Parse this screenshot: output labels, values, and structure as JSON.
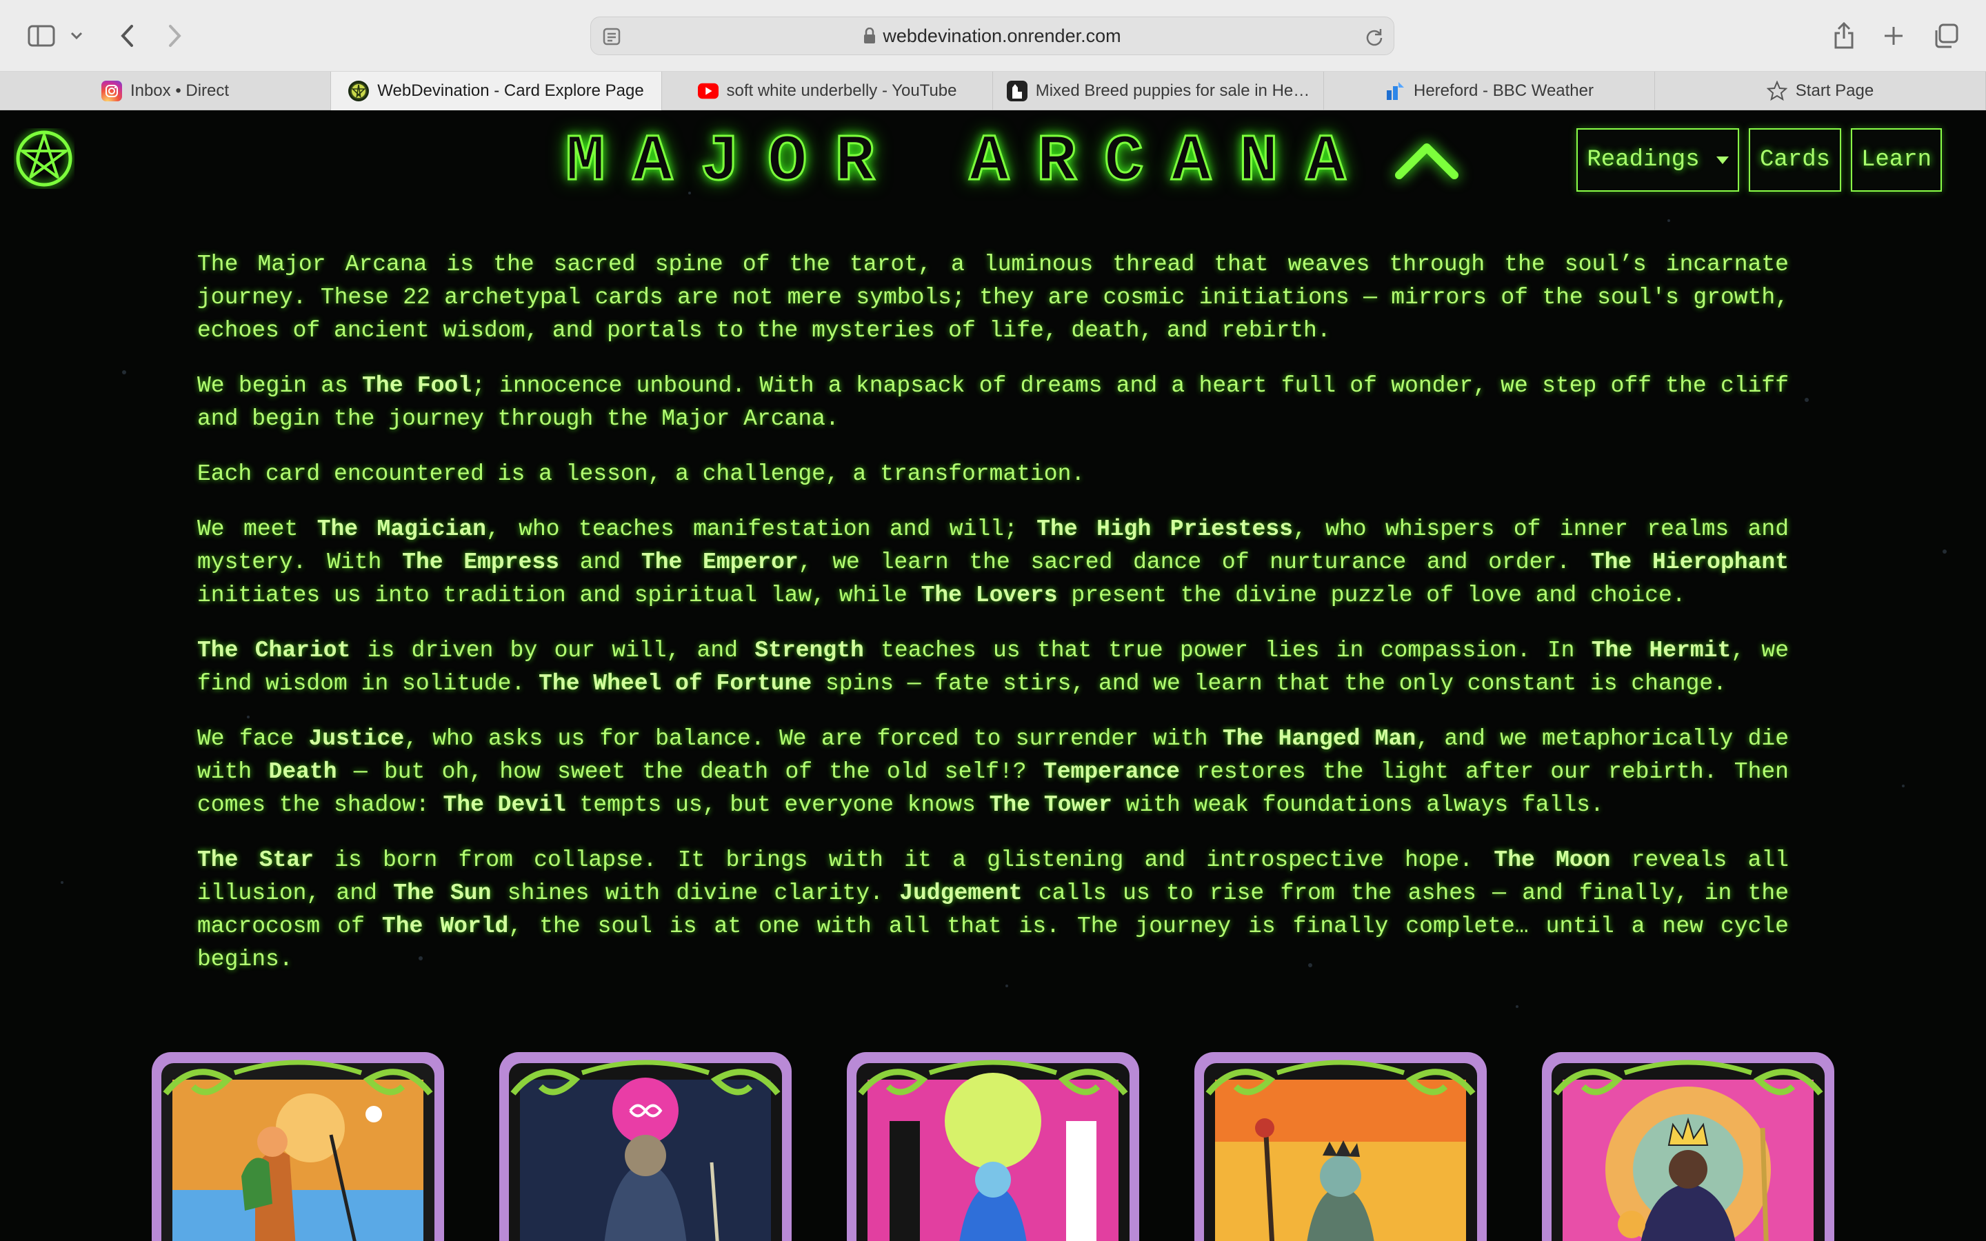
{
  "browser": {
    "url": "webdevination.onrender.com",
    "tabs": [
      {
        "label": "Inbox • Direct",
        "icon": "instagram-icon",
        "active": false
      },
      {
        "label": "WebDevination - Card Explore Page",
        "icon": "webdevination-favicon",
        "active": true
      },
      {
        "label": "soft white underbelly - YouTube",
        "icon": "youtube-icon",
        "active": false
      },
      {
        "label": "Mixed Breed puppies for sale in He…",
        "icon": "puppy-site-favicon",
        "active": false
      },
      {
        "label": "Hereford - BBC Weather",
        "icon": "bbc-weather-icon",
        "active": false
      },
      {
        "label": "Start Page",
        "icon": "star-icon",
        "active": false
      }
    ]
  },
  "header": {
    "title": "MAJOR ARCANA",
    "nav": {
      "readings": "Readings",
      "cards": "Cards",
      "learn": "Learn"
    }
  },
  "article": {
    "p1": [
      {
        "t": "The Major Arcana is the sacred spine of the tarot, a luminous thread that weaves through the soul’s incarnate journey. These 22 archetypal cards are not mere symbols; they are cosmic initiations — mirrors of the soul's growth, echoes of ancient wisdom, and portals to the mysteries of life, death, and rebirth.",
        "b": false
      }
    ],
    "p2": [
      {
        "t": "We begin as ",
        "b": false
      },
      {
        "t": "The Fool",
        "b": true
      },
      {
        "t": "; innocence unbound. With a knapsack of dreams and a heart full of wonder, we step off the cliff and begin the journey through the Major Arcana.",
        "b": false
      }
    ],
    "p3": [
      {
        "t": "Each card encountered is a lesson, a challenge, a transformation.",
        "b": false
      }
    ],
    "p4": [
      {
        "t": "We meet ",
        "b": false
      },
      {
        "t": "The Magician",
        "b": true
      },
      {
        "t": ", who teaches manifestation and will; ",
        "b": false
      },
      {
        "t": "The High Priestess",
        "b": true
      },
      {
        "t": ", who whispers of inner realms and mystery. With ",
        "b": false
      },
      {
        "t": "The Empress",
        "b": true
      },
      {
        "t": " and ",
        "b": false
      },
      {
        "t": "The Emperor",
        "b": true
      },
      {
        "t": ", we learn the sacred dance of nurturance and order. ",
        "b": false
      },
      {
        "t": "The Hierophant",
        "b": true
      },
      {
        "t": " initiates us into tradition and spiritual law, while ",
        "b": false
      },
      {
        "t": "The Lovers",
        "b": true
      },
      {
        "t": " present the divine puzzle of love and choice.",
        "b": false
      }
    ],
    "p5": [
      {
        "t": "The Chariot",
        "b": true
      },
      {
        "t": " is driven by our will, and ",
        "b": false
      },
      {
        "t": "Strength",
        "b": true
      },
      {
        "t": " teaches us that true power lies in compassion. In ",
        "b": false
      },
      {
        "t": "The Hermit",
        "b": true
      },
      {
        "t": ", we find wisdom in solitude. ",
        "b": false
      },
      {
        "t": "The Wheel of Fortune",
        "b": true
      },
      {
        "t": " spins — fate stirs, and we learn that the only constant is change.",
        "b": false
      }
    ],
    "p6": [
      {
        "t": "We face ",
        "b": false
      },
      {
        "t": "Justice",
        "b": true
      },
      {
        "t": ", who asks us for balance. We are forced to surrender with ",
        "b": false
      },
      {
        "t": "The Hanged Man",
        "b": true
      },
      {
        "t": ", and we metaphorically die with ",
        "b": false
      },
      {
        "t": "Death",
        "b": true
      },
      {
        "t": " — but oh, how sweet the death of the old self!? ",
        "b": false
      },
      {
        "t": "Temperance",
        "b": true
      },
      {
        "t": " restores the light after our rebirth. Then comes the shadow: ",
        "b": false
      },
      {
        "t": "The Devil",
        "b": true
      },
      {
        "t": " tempts us, but everyone knows ",
        "b": false
      },
      {
        "t": "The Tower",
        "b": true
      },
      {
        "t": " with weak foundations always falls.",
        "b": false
      }
    ],
    "p7": [
      {
        "t": "The Star",
        "b": true
      },
      {
        "t": " is born from collapse. It brings with it a glistening and introspective hope. ",
        "b": false
      },
      {
        "t": "The Moon",
        "b": true
      },
      {
        "t": " reveals all illusion, and ",
        "b": false
      },
      {
        "t": "The Sun",
        "b": true
      },
      {
        "t": " shines with divine clarity. ",
        "b": false
      },
      {
        "t": "Judgement",
        "b": true
      },
      {
        "t": " calls us to rise from the ashes — and finally, in the macrocosm of ",
        "b": false
      },
      {
        "t": "The World",
        "b": true
      },
      {
        "t": ", the soul is at one with all that is. The journey is finally complete… until a new cycle begins.",
        "b": false
      }
    ]
  },
  "cards": [
    {
      "id": "fool",
      "art": "fool-art"
    },
    {
      "id": "magician",
      "art": "magician-art"
    },
    {
      "id": "high-priestess",
      "art": "high-priestess-art"
    },
    {
      "id": "empress",
      "art": "empress-art"
    },
    {
      "id": "emperor",
      "art": "emperor-art"
    }
  ],
  "colors": {
    "neon": "#7dff3c",
    "text": "#b4ff72",
    "background": "#050605",
    "card_frame": "#b98ad6"
  }
}
